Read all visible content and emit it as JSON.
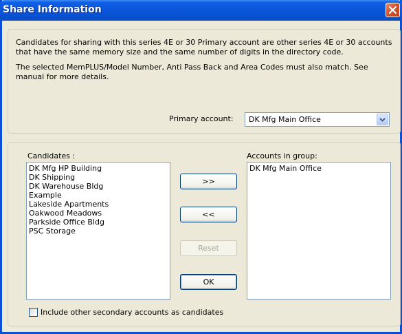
{
  "window": {
    "title": "Share Information"
  },
  "info": {
    "line1": "Candidates for sharing with this series 4E or 30 Primary account are other series 4E or 30 accounts",
    "line2": "that have the same memory size and the same number of digits in the directory code.",
    "line3": "The selected MemPLUS/Model Number, Anti Pass Back and Area Codes must also match.  See",
    "line4": "manual for more details."
  },
  "primary": {
    "label": "Primary account:",
    "value": "DK Mfg Main Office"
  },
  "candidates": {
    "label": "Candidates :",
    "items": [
      "DK Mfg HP Building",
      "DK Shipping",
      "DK Warehouse Bldg",
      "Example",
      "Lakeside Apartments",
      "Oakwood Meadows",
      "Parkside Office Bldg",
      "PSC Storage"
    ]
  },
  "group": {
    "label": "Accounts in group:",
    "items": [
      "DK Mfg Main Office"
    ]
  },
  "buttons": {
    "add": ">>",
    "remove": "<<",
    "reset": "Reset",
    "ok": "OK"
  },
  "checkbox": {
    "label": "Include other secondary accounts as candidates",
    "checked": false
  }
}
